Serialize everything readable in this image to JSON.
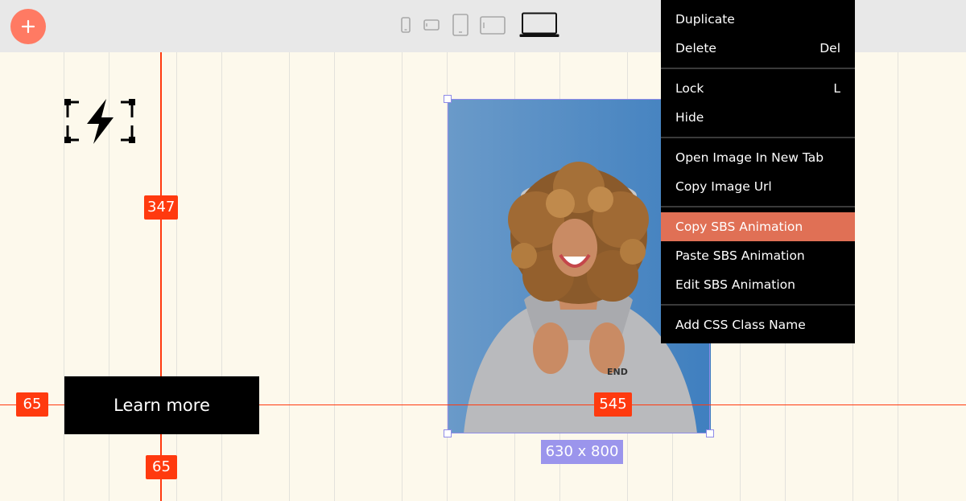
{
  "toolbar": {
    "add_icon": "plus-icon",
    "devices": [
      "mobile-portrait-icon",
      "mobile-landscape-icon",
      "tablet-portrait-icon",
      "tablet-landscape-icon",
      "laptop-icon"
    ],
    "active_device": "laptop-icon"
  },
  "canvas": {
    "logo_icon": "lightning-bolt-icon",
    "cta_label": "Learn more",
    "measurements": {
      "left_guide_value": "347",
      "bottom_guide_value": "65",
      "left_edge_value": "65",
      "image_offset_value": "545"
    },
    "image": {
      "size_label": "630 x 800",
      "description_icon": "photo-laughing-woman"
    }
  },
  "context_menu": {
    "items": [
      {
        "label": "Duplicate",
        "shortcut": ""
      },
      {
        "label": "Delete",
        "shortcut": "Del"
      },
      {
        "label": "Lock",
        "shortcut": "L"
      },
      {
        "label": "Hide",
        "shortcut": ""
      },
      {
        "label": "Open Image In New Tab",
        "shortcut": ""
      },
      {
        "label": "Copy Image Url",
        "shortcut": ""
      },
      {
        "label": "Copy SBS Animation",
        "shortcut": ""
      },
      {
        "label": "Paste SBS Animation",
        "shortcut": ""
      },
      {
        "label": "Edit SBS Animation",
        "shortcut": ""
      },
      {
        "label": "Add CSS Class Name",
        "shortcut": ""
      }
    ],
    "highlighted": "Copy SBS Animation"
  },
  "colors": {
    "accent": "#ff3a0f",
    "selection": "#8f8be8",
    "menu_highlight": "#e07055",
    "canvas_bg": "#fdf9ec"
  }
}
